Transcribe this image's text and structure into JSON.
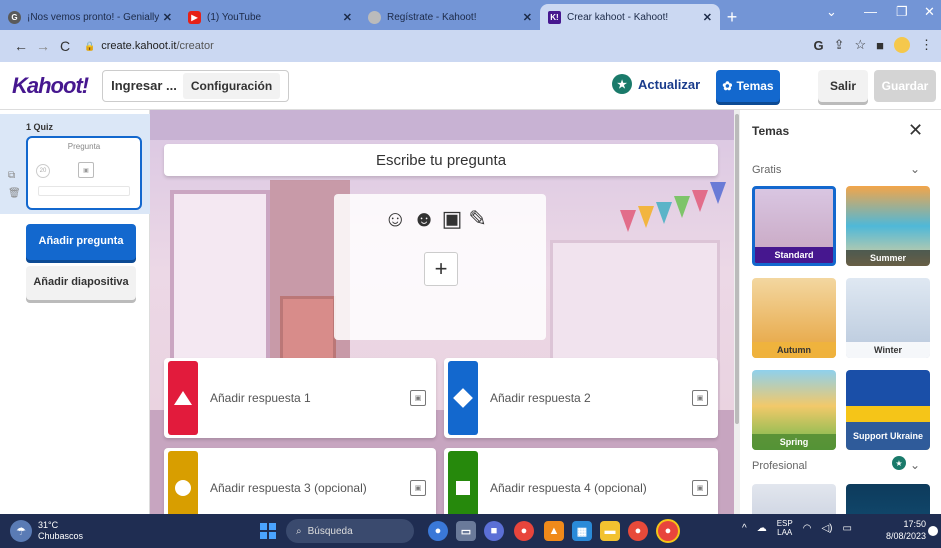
{
  "browser": {
    "tabs": [
      {
        "label": "¡Nos vemos pronto! - Genially",
        "favicon_color": "#5a5a5a",
        "active": false
      },
      {
        "label": "(1) YouTube",
        "favicon_color": "#e62117",
        "active": false
      },
      {
        "label": "Regístrate - Kahoot!",
        "favicon_color": "#bbbbbb",
        "active": false
      },
      {
        "label": "Crear kahoot - Kahoot!",
        "favicon_color": "#46178f",
        "active": true
      }
    ],
    "new_tab": "+",
    "url_host": "create.kahoot.it",
    "url_path": "/creator"
  },
  "header": {
    "logo": "Kahoot!",
    "title_input": "Ingresar ...",
    "settings_label": "Configuración",
    "upgrade_label": "Actualizar",
    "themes_label": "Temas",
    "exit_label": "Salir",
    "save_label": "Guardar"
  },
  "sidebar": {
    "slide_number": "1 Quiz",
    "slide_placeholder": "Pregunta",
    "slide_timer": "20",
    "add_question": "Añadir pregunta",
    "add_slide": "Añadir diapositiva"
  },
  "editor": {
    "question_placeholder": "Escribe tu pregunta",
    "answers": [
      {
        "label": "Añadir respuesta 1",
        "color": "#e21b3c",
        "shape": "triangle"
      },
      {
        "label": "Añadir respuesta 2",
        "color": "#1368ce",
        "shape": "diamond"
      },
      {
        "label": "Añadir respuesta 3 (opcional)",
        "color": "#d89e00",
        "shape": "circle"
      },
      {
        "label": "Añadir respuesta 4 (opcional)",
        "color": "#26890c",
        "shape": "square"
      }
    ]
  },
  "themes_panel": {
    "title": "Temas",
    "section_free": "Gratis",
    "section_pro": "Profesional",
    "themes": [
      {
        "name": "Standard",
        "selected": true
      },
      {
        "name": "Summer",
        "selected": false
      },
      {
        "name": "Autumn",
        "selected": false
      },
      {
        "name": "Winter",
        "selected": false
      },
      {
        "name": "Spring",
        "selected": false
      },
      {
        "name": "Support Ukraine",
        "selected": false
      }
    ]
  },
  "taskbar": {
    "weather_temp": "31°C",
    "weather_desc": "Chubascos",
    "search_label": "Búsqueda",
    "lang_1": "ESP",
    "lang_2": "LAA",
    "time": "17:50",
    "date": "8/08/2023"
  }
}
